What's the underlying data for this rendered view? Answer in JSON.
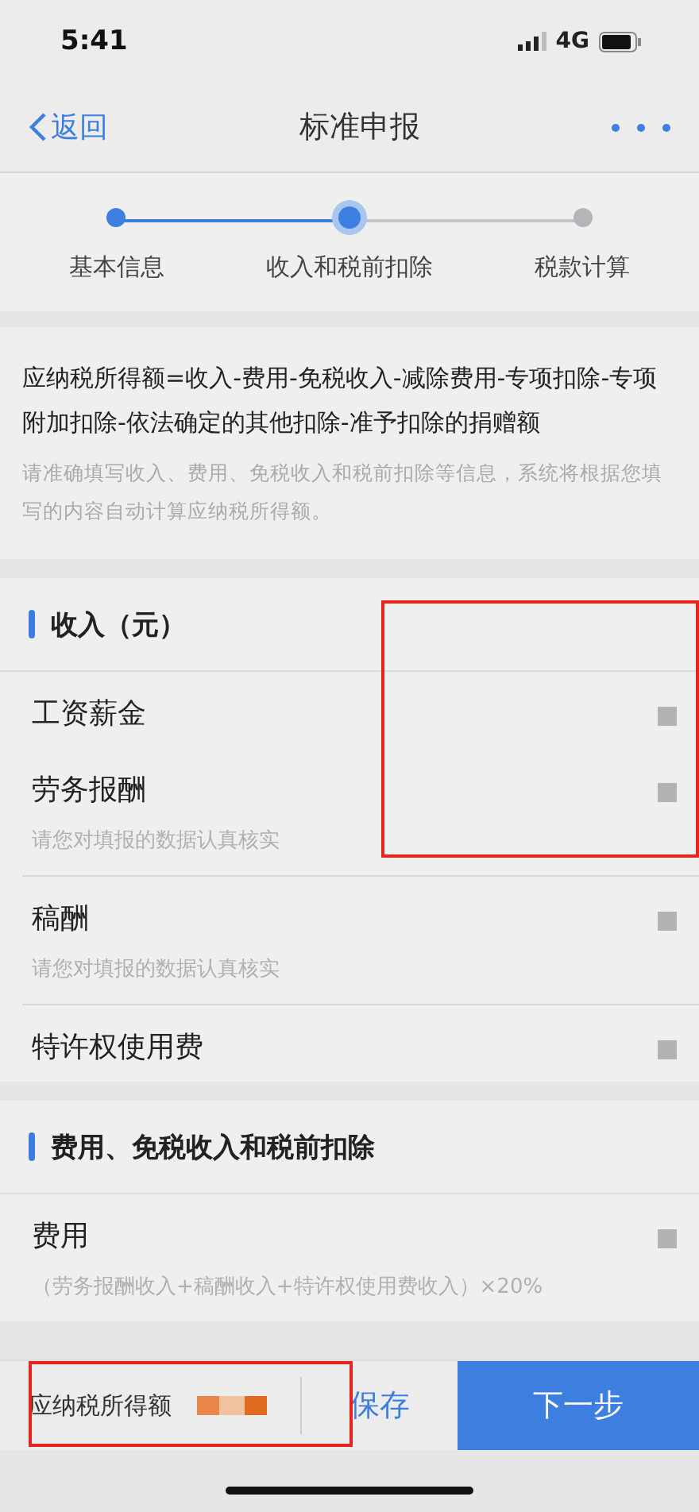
{
  "status_bar": {
    "time": "5:41",
    "network": "4G"
  },
  "nav": {
    "back": "返回",
    "title": "标准申报"
  },
  "steps": [
    {
      "label": "基本信息",
      "completed": true,
      "selected": false
    },
    {
      "label": "收入和税前扣除",
      "completed": true,
      "selected": true
    },
    {
      "label": "税款计算",
      "completed": false,
      "selected": false
    }
  ],
  "formula": {
    "text": "应纳税所得额=收入-费用-免税收入-减除费用-专项扣除-专项附加扣除-依法确定的其他扣除-准予扣除的捐赠额",
    "hint": "请准确填写收入、费用、免税收入和税前扣除等信息，系统将根据您填写的内容自动计算应纳税所得额。"
  },
  "income": {
    "title": "收入（元）",
    "rows": [
      {
        "label": "工资薪金"
      },
      {
        "label": "劳务报酬",
        "note": "请您对填报的数据认真核实"
      },
      {
        "label": "稿酬",
        "note": "请您对填报的数据认真核实"
      },
      {
        "label": "特许权使用费"
      }
    ]
  },
  "deductions": {
    "title": "费用、免税收入和税前扣除",
    "rows": [
      {
        "label": "费用",
        "note": "（劳务报酬收入+稿酬收入+特许权使用费收入）×20%"
      }
    ]
  },
  "footer": {
    "total_label": "应纳税所得额",
    "save": "保存",
    "next": "下一步"
  }
}
